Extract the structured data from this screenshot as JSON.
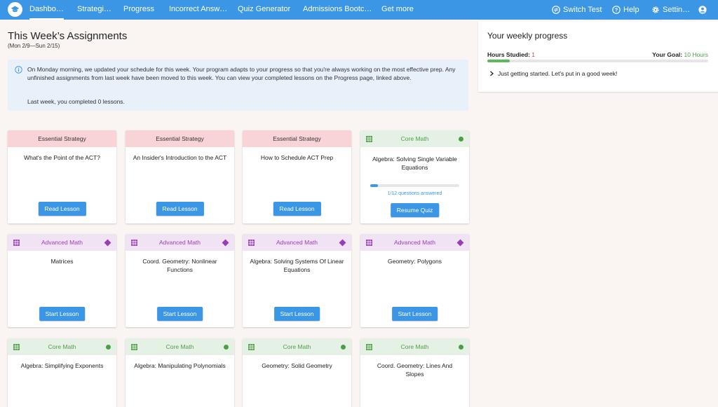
{
  "nav": {
    "items": [
      {
        "label": "Dashbo…",
        "active": true
      },
      {
        "label": "Strategi…"
      },
      {
        "label": "Progress"
      },
      {
        "label": "Incorrect Answ…"
      },
      {
        "label": "Quiz Generator"
      },
      {
        "label": "Admissions Bootc…"
      },
      {
        "label": "Get more"
      }
    ],
    "switch_test": "Switch Test",
    "help": "Help",
    "settings": "Settin…"
  },
  "header": {
    "title": "This Week’s Assignments",
    "date_range": "(Mon 2/9—Sun 2/15)"
  },
  "info": {
    "message": "On Monday morning, we updated your schedule for this week. Your program adapts to your progress so that you're always working on the most effective prep. Any unfinished assignments from last week have been moved to this week. You can view your completed lessons on the Progress page, linked above.",
    "last_week": "Last week, you completed 0 lessons."
  },
  "cards": [
    {
      "category": "Essential Strategy",
      "title": "What's the Point of the ACT?",
      "button": "Read Lesson"
    },
    {
      "category": "Essential Strategy",
      "title": "An Insider's Introduction to the ACT",
      "button": "Read Lesson"
    },
    {
      "category": "Essential Strategy",
      "title": "How to Schedule ACT Prep",
      "button": "Read Lesson"
    },
    {
      "category": "Core Math",
      "title": "Algebra: Solving Single Variable Equations",
      "button": "Resume Quiz",
      "progress_text": "1/12 questions answered",
      "progress_fraction": 0.0833
    },
    {
      "category": "Advanced Math",
      "title": "Matrices",
      "button": "Start Lesson"
    },
    {
      "category": "Advanced Math",
      "title": "Coord. Geometry: Nonlinear Functions",
      "button": "Start Lesson"
    },
    {
      "category": "Advanced Math",
      "title": "Algebra: Solving Systems Of Linear Equations",
      "button": "Start Lesson"
    },
    {
      "category": "Advanced Math",
      "title": "Geometry: Polygons",
      "button": "Start Lesson"
    },
    {
      "category": "Core Math",
      "title": "Algebra: Simplifying Exponents"
    },
    {
      "category": "Core Math",
      "title": "Algebra: Manipulating Polynomials"
    },
    {
      "category": "Core Math",
      "title": "Geometry: Solid Geometry"
    },
    {
      "category": "Core Math",
      "title": "Coord. Geometry: Lines And Slopes"
    }
  ],
  "weekly": {
    "title": "Your weekly progress",
    "hours_label": "Hours Studied:",
    "hours_value": "1",
    "goal_label": "Your Goal:",
    "goal_value": "10 Hours",
    "progress_fraction": 0.1,
    "message": "Just getting started. Let's put in a good week!"
  },
  "colors": {
    "accent": "#3b96e6",
    "essential_bg": "#f8d4d6",
    "core_green": "#4e9e48",
    "advanced_purple": "#9a3fb3"
  }
}
